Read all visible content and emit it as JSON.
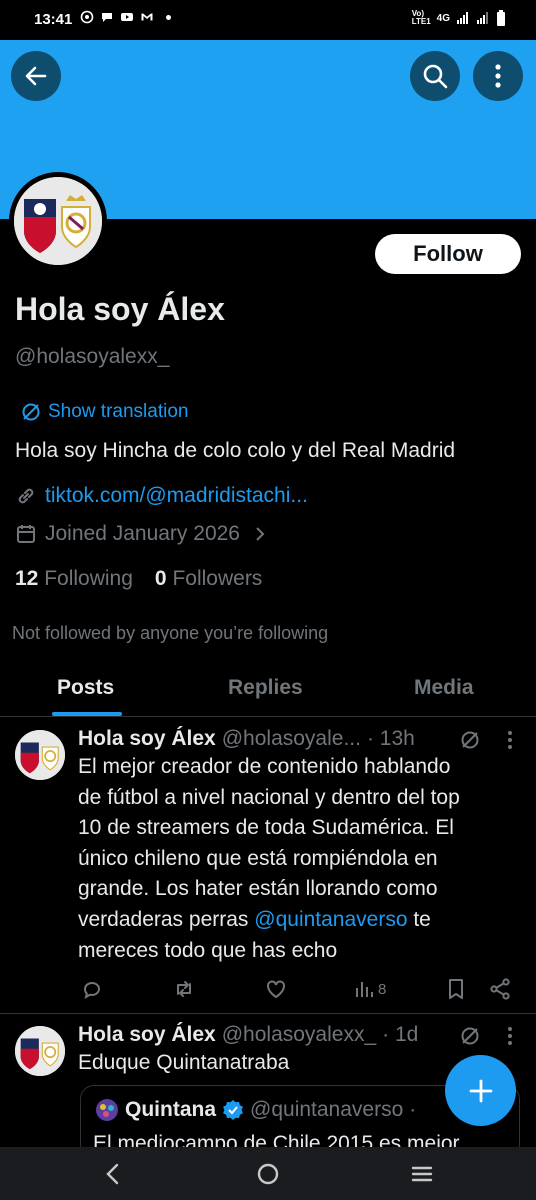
{
  "status_bar": {
    "time": "13:41",
    "network_label": "4G"
  },
  "profile": {
    "display_name": "Hola soy Álex",
    "handle": "@holasoyalexx_",
    "follow_label": "Follow",
    "translation_label": "Show translation",
    "bio": "Hola soy Hincha de colo colo y del Real Madrid",
    "link": "tiktok.com/@madridistachi...",
    "joined": "Joined January 2026",
    "following_count": "12",
    "following_label": "Following",
    "followers_count": "0",
    "followers_label": "Followers",
    "not_followed_text": "Not followed by anyone you’re following"
  },
  "tabs": [
    {
      "label": "Posts",
      "active": true
    },
    {
      "label": "Replies",
      "active": false
    },
    {
      "label": "Media",
      "active": false
    }
  ],
  "posts": [
    {
      "name": "Hola soy Álex",
      "handle": "@holasoyale...",
      "time": "· 13h",
      "text_lines": [
        "El mejor creador de contenido hablando",
        "de fútbol a nivel nacional  y dentro del top",
        "10 de streamers de toda Sudamérica.  El",
        "único chileno que está rompiéndola en",
        "grande. Los hater están llorando como"
      ],
      "text_pre_mention": "verdaderas perras ",
      "mention": "@quintanaverso",
      "text_post_mention": " te",
      "text_last_line": "mereces todo que has echo",
      "views": "8"
    },
    {
      "name": "Hola soy Álex",
      "handle": "@holasoyalexx_",
      "time": "· 1d",
      "text": "Eduque Quintanatraba",
      "quote": {
        "name": "Quintana",
        "handle": "@quintanaverso",
        "time_fragment": "·",
        "text": "El mediocampo de Chile 2015 es mejor"
      }
    }
  ],
  "colors": {
    "accent": "#1d9bf0",
    "banner": "#1ea1f1",
    "background": "#000000"
  }
}
